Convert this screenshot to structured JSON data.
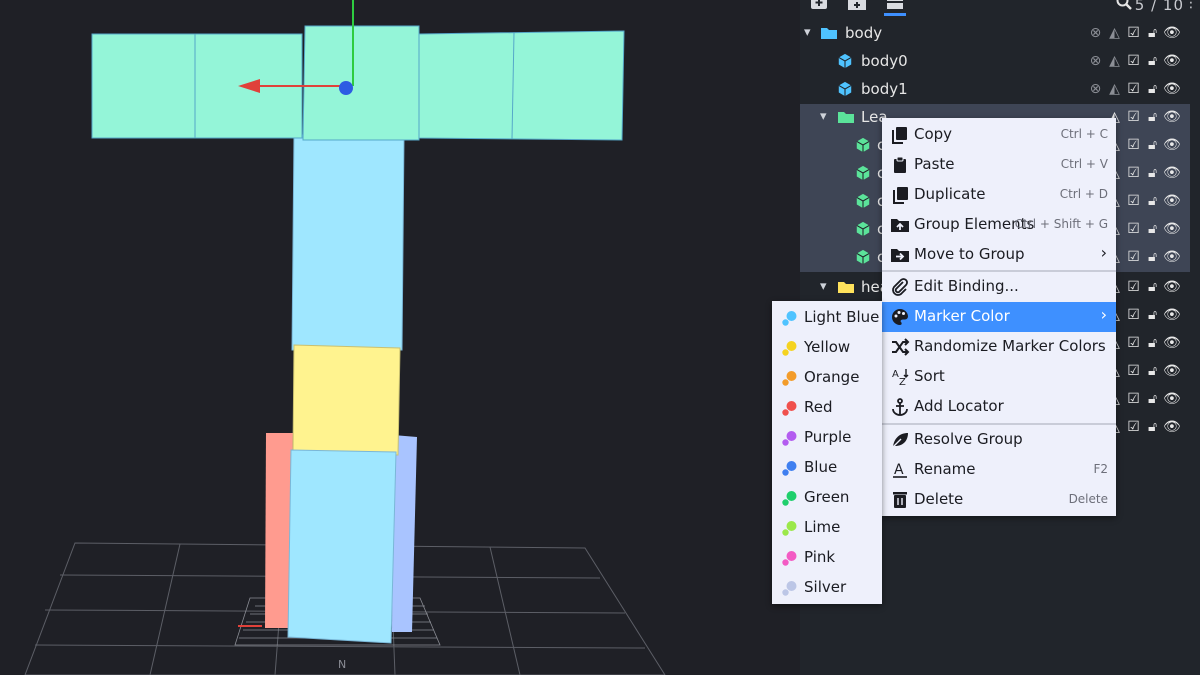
{
  "toolbar": {
    "add_cube_icon": "plus-icon",
    "add_group_icon": "add-folder-icon",
    "outliner_tab_icon": "outliner-icon",
    "search_icon": "search-icon",
    "counter": "5 / 10"
  },
  "outliner": {
    "rows": [
      {
        "label": "body",
        "type": "group",
        "color": "#4fc3ff"
      },
      {
        "label": "body0",
        "type": "cube",
        "color": "#4fc3ff"
      },
      {
        "label": "body1",
        "type": "cube",
        "color": "#4fc3ff"
      },
      {
        "label": "Lea",
        "type": "group",
        "color": "#5be39a"
      },
      {
        "label": "c",
        "type": "cube",
        "color": "#5be39a"
      },
      {
        "label": "c",
        "type": "cube",
        "color": "#5be39a"
      },
      {
        "label": "c",
        "type": "cube",
        "color": "#5be39a"
      },
      {
        "label": "c",
        "type": "cube",
        "color": "#5be39a"
      },
      {
        "label": "c",
        "type": "cube",
        "color": "#5be39a"
      },
      {
        "label": "hea",
        "type": "group",
        "color": "#ffe25c"
      }
    ]
  },
  "context_menu": {
    "items": [
      {
        "label": "Copy",
        "shortcut": "Ctrl + C",
        "icon": "copy-icon"
      },
      {
        "label": "Paste",
        "shortcut": "Ctrl + V",
        "icon": "paste-icon"
      },
      {
        "label": "Duplicate",
        "shortcut": "Ctrl + D",
        "icon": "duplicate-icon"
      },
      {
        "label": "Group Elements",
        "shortcut": "Ctrl + Shift + G",
        "icon": "group-elements-icon"
      },
      {
        "label": "Move to Group",
        "shortcut": "",
        "icon": "move-to-group-icon"
      },
      {
        "label": "Edit Binding...",
        "shortcut": "",
        "icon": "paperclip-icon"
      },
      {
        "label": "Marker Color",
        "shortcut": "",
        "icon": "palette-icon"
      },
      {
        "label": "Randomize Marker Colors",
        "shortcut": "",
        "icon": "shuffle-icon"
      },
      {
        "label": "Sort",
        "shortcut": "",
        "icon": "sort-alpha-icon"
      },
      {
        "label": "Add Locator",
        "shortcut": "",
        "icon": "anchor-icon"
      },
      {
        "label": "Resolve Group",
        "shortcut": "",
        "icon": "leaf-icon"
      },
      {
        "label": "Rename",
        "shortcut": "F2",
        "icon": "rename-icon"
      },
      {
        "label": "Delete",
        "shortcut": "Delete",
        "icon": "trash-icon"
      }
    ]
  },
  "color_menu": {
    "items": [
      {
        "label": "Light Blue",
        "color": "#4fc3ff"
      },
      {
        "label": "Yellow",
        "color": "#f5d320"
      },
      {
        "label": "Orange",
        "color": "#f39c2a"
      },
      {
        "label": "Red",
        "color": "#f0504d"
      },
      {
        "label": "Purple",
        "color": "#b35cf0"
      },
      {
        "label": "Blue",
        "color": "#3f7ff0"
      },
      {
        "label": "Green",
        "color": "#1fcf6c"
      },
      {
        "label": "Lime",
        "color": "#9be84a"
      },
      {
        "label": "Pink",
        "color": "#f35bc4"
      },
      {
        "label": "Silver",
        "color": "#bcc6e6"
      }
    ]
  }
}
